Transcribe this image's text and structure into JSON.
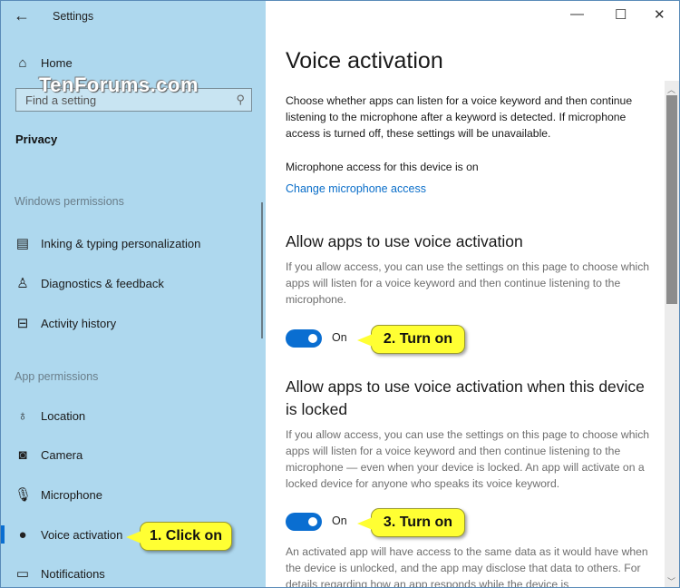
{
  "window": {
    "app_title": "Settings",
    "back_icon": "back-arrow-icon",
    "controls": {
      "minimize": "—",
      "maximize": "☐",
      "close": "✕"
    }
  },
  "watermark": "TenForums.com",
  "sidebar": {
    "home": {
      "label": "Home",
      "icon": "home-icon"
    },
    "search": {
      "placeholder": "Find a setting",
      "icon": "search-icon"
    },
    "category": "Privacy",
    "windows_permissions_header": "Windows permissions",
    "windows_permissions": [
      {
        "label": "Inking & typing personalization",
        "icon": "clipboard-icon"
      },
      {
        "label": "Diagnostics & feedback",
        "icon": "feedback-icon"
      },
      {
        "label": "Activity history",
        "icon": "timeline-icon"
      }
    ],
    "app_permissions_header": "App permissions",
    "app_permissions": [
      {
        "label": "Location",
        "icon": "location-icon"
      },
      {
        "label": "Camera",
        "icon": "camera-icon"
      },
      {
        "label": "Microphone",
        "icon": "microphone-icon"
      },
      {
        "label": "Voice activation",
        "icon": "voice-activation-icon",
        "selected": true
      },
      {
        "label": "Notifications",
        "icon": "notifications-icon"
      }
    ]
  },
  "main": {
    "title": "Voice activation",
    "intro": "Choose whether apps can listen for a voice keyword and then continue listening to the microphone after a keyword is detected. If microphone access is turned off, these settings will be unavailable.",
    "mic_status": "Microphone access for this device is on",
    "change_link": "Change microphone access",
    "section1": {
      "heading": "Allow apps to use voice activation",
      "desc": "If you allow access, you can use the settings on this page to choose which apps will listen for a voice keyword and then continue listening to the microphone.",
      "toggle_state": "On",
      "toggle_on": true
    },
    "section2": {
      "heading": "Allow apps to use voice activation when this device is locked",
      "desc": "If you allow access, you can use the settings on this page to choose which apps will listen for a voice keyword and then continue listening to the microphone — even when your device is locked. An app will activate on a locked device for anyone who speaks its voice keyword.",
      "toggle_state": "On",
      "toggle_on": true,
      "note": "An activated app will have access to the same data as it would have when the device is unlocked, and the app may disclose that data to others. For details regarding how an app responds while the device is"
    }
  },
  "callouts": {
    "step1": "1. Click on",
    "step2": "2. Turn on",
    "step3": "3. Turn on"
  },
  "colors": {
    "accent": "#0a6ed1",
    "sidebar_bg": "#aed8ee",
    "callout": "#ffff33",
    "link": "#0a6ec9"
  }
}
